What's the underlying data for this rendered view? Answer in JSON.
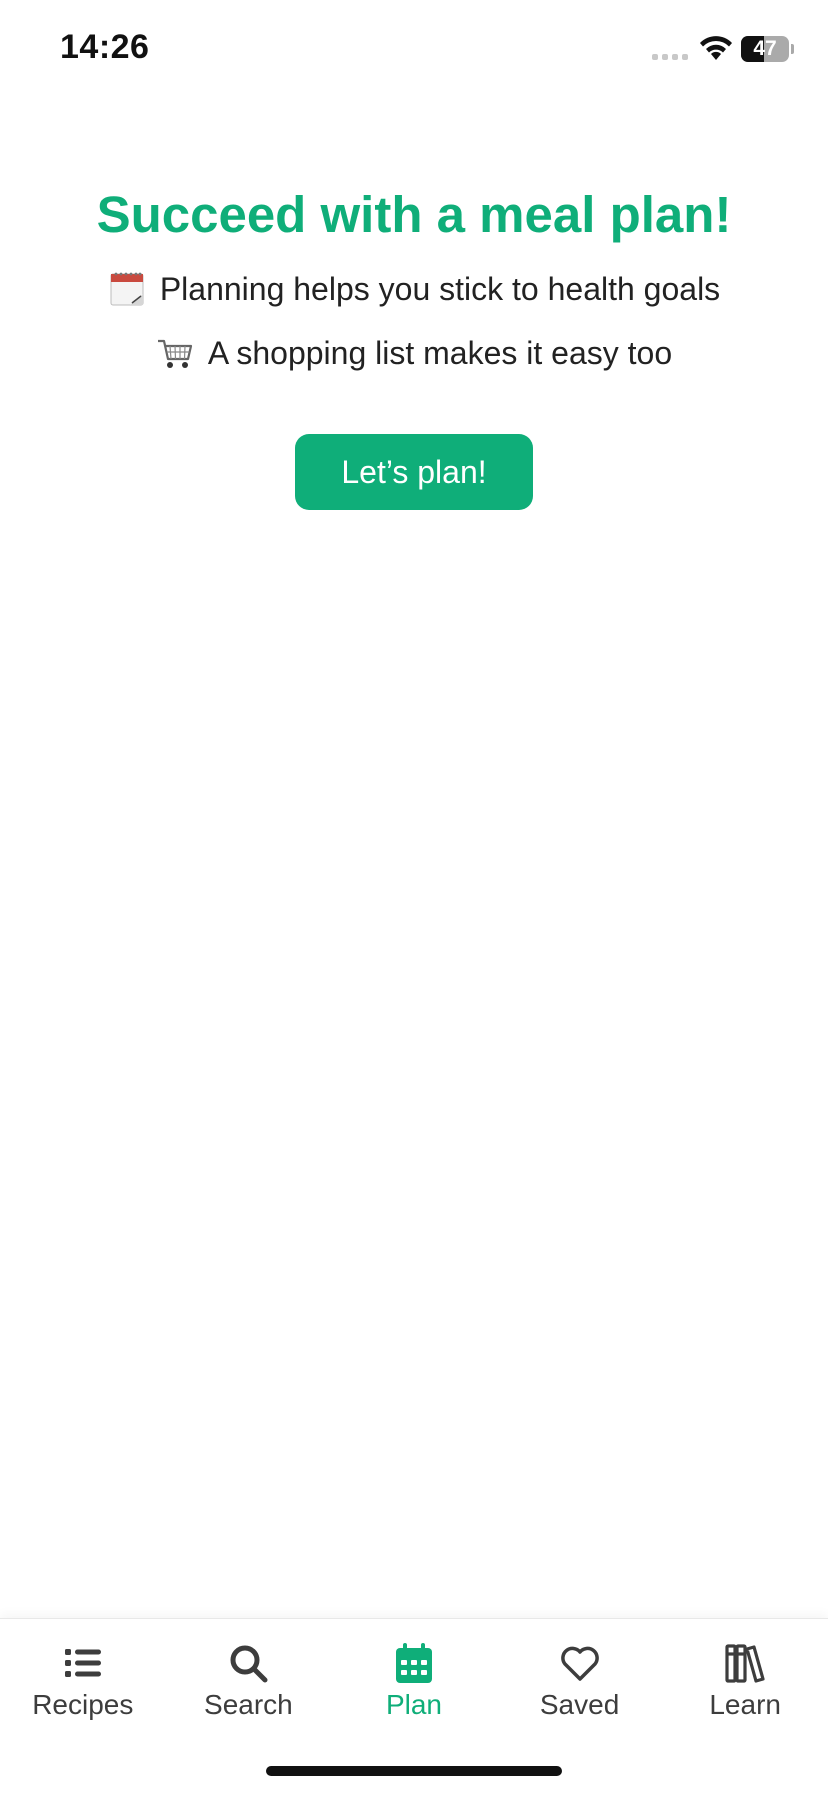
{
  "status_bar": {
    "time": "14:26",
    "battery_level": "47",
    "battery_fraction": 0.47
  },
  "main": {
    "headline": "Succeed with a meal plan!",
    "benefits": [
      {
        "icon": "calendar-icon",
        "text": "Planning helps you stick to health goals"
      },
      {
        "icon": "shopping-cart-icon",
        "text": "A shopping list makes it easy too"
      }
    ],
    "cta_label": "Let’s plan!"
  },
  "tab_bar": {
    "active": "Plan",
    "items": [
      {
        "label": "Recipes",
        "icon": "list-icon"
      },
      {
        "label": "Search",
        "icon": "search-icon"
      },
      {
        "label": "Plan",
        "icon": "calendar-icon"
      },
      {
        "label": "Saved",
        "icon": "heart-icon"
      },
      {
        "label": "Learn",
        "icon": "books-icon"
      }
    ]
  },
  "colors": {
    "accent": "#0fae79",
    "text": "#222222",
    "tab_inactive": "#3d3d3d"
  }
}
